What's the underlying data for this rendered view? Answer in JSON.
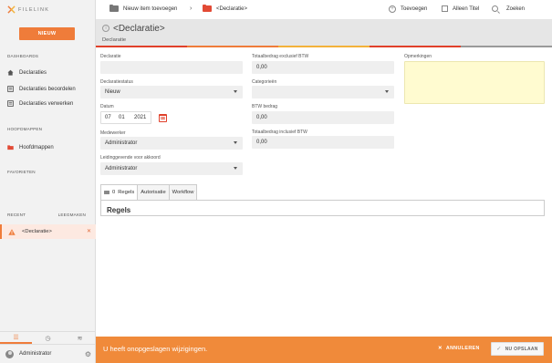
{
  "brand": {
    "name": "FILELINK",
    "accent": "#ef7c3a"
  },
  "sidebar": {
    "new_button": "NIEUW",
    "dashboards_label": "DASHBOARDS",
    "dashboards": [
      {
        "label": "Declaraties",
        "icon": "home-icon"
      },
      {
        "label": "Declaraties beoordelen",
        "icon": "form-icon"
      },
      {
        "label": "Declaraties verwerken",
        "icon": "form-icon"
      }
    ],
    "folders_label": "HOOFDMAPPEN",
    "folders": [
      {
        "label": "Hoofdmappen",
        "icon": "folder-icon"
      }
    ],
    "favorites_label": "FAVORIETEN",
    "recent_label": "RECENT",
    "clear_label": "LEEGMAKEN",
    "recent_items": [
      {
        "label": "<Declaratie>",
        "icon": "warning-icon"
      }
    ],
    "bottom_tabs": [
      "list-icon",
      "clock-icon",
      "stack-icon"
    ],
    "user": "Administrator"
  },
  "topbar": {
    "breadcrumb_new": "Nieuw item toevoegen",
    "breadcrumb_current": "<Declaratie>",
    "add_label": "Toevoegen",
    "title_only_label": "Alleen Titel",
    "search_label": "Zoeken"
  },
  "header": {
    "title": "<Declaratie>",
    "subtitle": "Declaratie",
    "stripe_colors": [
      "#e0402a",
      "#ef7c3a",
      "#f3b23a",
      "#e0402a",
      "#9a9a9a"
    ]
  },
  "form": {
    "declaratie": {
      "label": "Declaratie",
      "value": ""
    },
    "status": {
      "label": "Declaratiestatus",
      "value": "Nieuw"
    },
    "datum": {
      "label": "Datum",
      "day": "07",
      "month": "01",
      "year": "2021"
    },
    "medewerker": {
      "label": "Medewerker",
      "value": "Administrator"
    },
    "leidinggevende": {
      "label": "Leidinggevende voor akkoord",
      "value": "Administrator"
    },
    "totaal_excl": {
      "label": "Totaalbedrag exclusief BTW",
      "value": "0,00"
    },
    "categorieen": {
      "label": "Categorieën",
      "value": ""
    },
    "btw": {
      "label": "BTW bedrag",
      "value": "0,00"
    },
    "totaal_incl": {
      "label": "Totaalbedrag inclusief BTW",
      "value": "0,00"
    },
    "opmerkingen": {
      "label": "Opmerkingen",
      "value": ""
    }
  },
  "tabs": {
    "items": [
      {
        "count": "0",
        "label": "Regels"
      },
      {
        "label": "Autorisatie"
      },
      {
        "label": "Workflow"
      }
    ],
    "panel_title": "Regels"
  },
  "bottombar": {
    "message": "U heeft onopgeslagen wijzigingen.",
    "cancel_label": "ANNULEREN",
    "save_label": "NU OPSLAAN",
    "color": "#f08a3a"
  }
}
